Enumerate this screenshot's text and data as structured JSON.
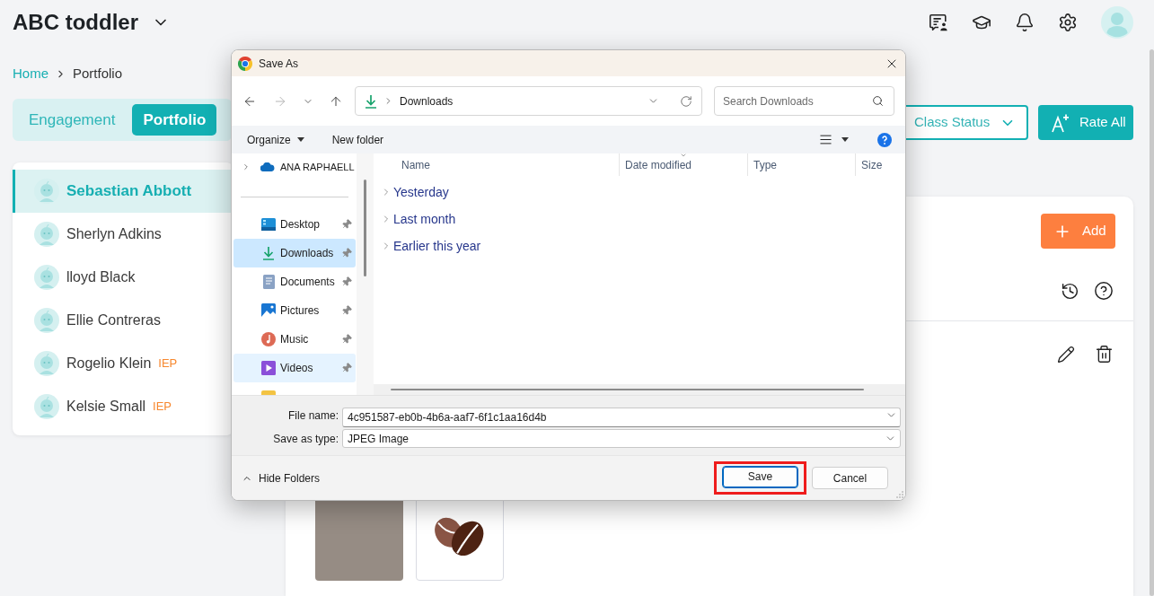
{
  "header": {
    "title": "ABC toddler"
  },
  "breadcrumb": [
    {
      "label": "Home",
      "current": false
    },
    {
      "label": "Portfolio",
      "current": true
    }
  ],
  "tabs": [
    {
      "label": "Engagement",
      "selected": false
    },
    {
      "label": "Portfolio",
      "selected": true
    }
  ],
  "actions": {
    "class_status": "Class Status",
    "rate_all": "Rate All"
  },
  "students": [
    {
      "name": "Sebastian Abbott",
      "selected": true
    },
    {
      "name": "Sherlyn Adkins",
      "selected": false
    },
    {
      "name": "lloyd Black",
      "selected": false
    },
    {
      "name": "Ellie Contreras",
      "selected": false
    },
    {
      "name": "Rogelio Klein",
      "selected": false,
      "tag": "IEP"
    },
    {
      "name": "Kelsie Small",
      "selected": false,
      "tag": "IEP"
    }
  ],
  "portfolio": {
    "add_button": "Add"
  },
  "dialog": {
    "title": "Save As",
    "nav_buttons": [
      {
        "kind": "back",
        "disabled": false
      },
      {
        "kind": "forward",
        "disabled": true
      },
      {
        "kind": "recent",
        "disabled": false
      },
      {
        "kind": "up",
        "disabled": false
      }
    ],
    "address": "Downloads",
    "search": {
      "placeholder": "Search Downloads"
    },
    "commands": [
      {
        "label": "Organize",
        "dropdown": true
      },
      {
        "label": "New folder",
        "dropdown": false
      }
    ],
    "account": {
      "label": "ANA RAPHAELL",
      "expanded": false
    },
    "quick_access": [
      {
        "label": "Desktop",
        "selected": false,
        "hovered": false,
        "pinned": true
      },
      {
        "label": "Downloads",
        "selected": true,
        "hovered": false,
        "pinned": true
      },
      {
        "label": "Documents",
        "selected": false,
        "hovered": false,
        "pinned": true
      },
      {
        "label": "Pictures",
        "selected": false,
        "hovered": false,
        "pinned": true
      },
      {
        "label": "Music",
        "selected": false,
        "hovered": false,
        "pinned": true
      },
      {
        "label": "Videos",
        "selected": false,
        "hovered": true,
        "pinned": true
      }
    ],
    "columns": [
      {
        "label": "Name",
        "sorted": false
      },
      {
        "label": "Date modified",
        "sorted": true
      },
      {
        "label": "Type",
        "sorted": false
      },
      {
        "label": "Size",
        "sorted": false
      }
    ],
    "groups": [
      {
        "label": "Yesterday",
        "expanded": false
      },
      {
        "label": "Last month",
        "expanded": false
      },
      {
        "label": "Earlier this year",
        "expanded": false
      }
    ],
    "file_name": {
      "label": "File name:",
      "value": "4c951587-eb0b-4b6a-aaf7-6f1c1aa16d4b"
    },
    "save_as_type": {
      "label": "Save as type:",
      "value": "JPEG Image"
    },
    "hide_folders": "Hide Folders",
    "buttons": [
      {
        "label": "Save",
        "default": true,
        "highlighted": true
      },
      {
        "label": "Cancel",
        "default": false,
        "highlighted": false
      }
    ]
  }
}
